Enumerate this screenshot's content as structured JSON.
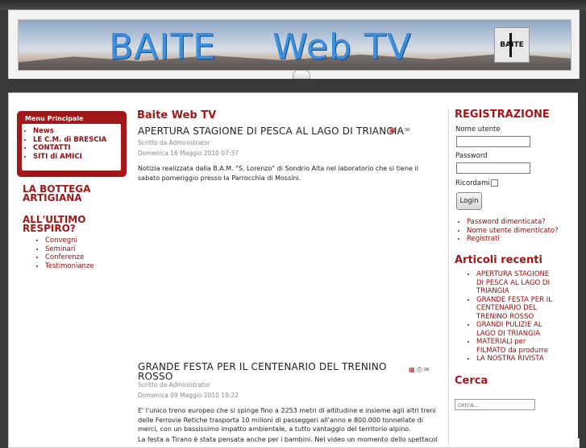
{
  "banner": {
    "title_part1": "BAITE",
    "title_part2": "Web TV",
    "logo_text": "BAITE"
  },
  "main_menu": {
    "title": "Menu Principale",
    "items": [
      "News",
      "LE C.M. di BRESCIA",
      "CONTATTI",
      "SITI di AMICI"
    ]
  },
  "left": {
    "heading1": "LA BOTTEGA ARTIGIANA",
    "heading2": "ALL'ULTIMO RESPIRO?",
    "items": [
      "Convegni",
      "Seminari",
      "Conferenze",
      "Testimonianze"
    ]
  },
  "center": {
    "title": "Baite Web TV",
    "articles": [
      {
        "title": "APERTURA STAGIONE DI PESCA AL LAGO DI TRIANGIA",
        "author": "Scritto da Administrator",
        "date": "Domenica 16 Maggio 2010 07:37",
        "body": "Notizia realizzata dalla B.A.M. \"S. Lorenzo\" di Sondrio Alta nel laboratorio che si tiene il sabato pomeriggio presso la Parrocchia di Mossini."
      },
      {
        "title": "GRANDE FESTA PER IL CENTENARIO DEL TRENINO ROSSO",
        "author": "Scritto da Administrator",
        "date": "Domenica 09 Maggio 2010 19:22",
        "body": "E' l'unico treno europeo che si spinge fino a 2253 metri di altitudine e insieme agli altri treni delle Ferrovie Retiche trasporta 10 milioni di passeggeri all'anno e 800.000 tonnellate di merci, con un bassissimo impatto ambientale, a tutto vantaggio del territorio alpino.",
        "body2": "La festa a Tirano è stata pensata anche per i bambini. Nel video un momento dello spettacolo dei"
      }
    ]
  },
  "right": {
    "login_heading": "REGISTRAZIONE",
    "username_label": "Nome utente",
    "password_label": "Password",
    "remember_label": "Ricordami",
    "login_button": "Login",
    "links": [
      "Password dimenticata?",
      "Nome utente dimenticato?",
      "Registrati"
    ],
    "recent_heading": "Articoli recenti",
    "recent": [
      "APERTURA STAGIONE DI PESCA AL LAGO DI TRIANGIA",
      "GRANDE FESTA PER IL CENTENARIO DEL TRENINO ROSSO",
      "GRANDI PULIZIE AL LAGO DI TRIANGIA",
      "MATERIALI per FILMATO da produrre",
      "LA NOSTRA RIVISTA"
    ],
    "search_heading": "Cerca",
    "search_placeholder": "cerca..."
  },
  "colors": {
    "accent": "#a01818",
    "link": "#8b0e0e",
    "banner_text": "#3b8fe0"
  }
}
